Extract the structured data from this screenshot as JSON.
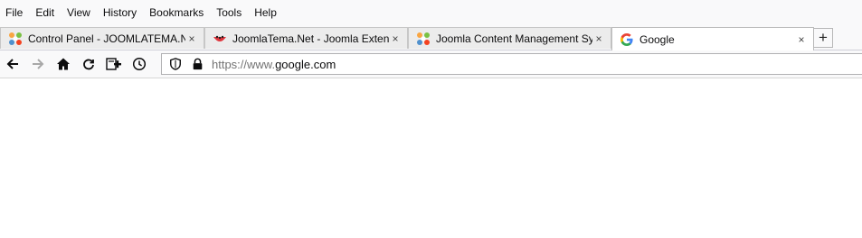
{
  "menu": {
    "items": [
      {
        "label": "File"
      },
      {
        "label": "Edit"
      },
      {
        "label": "View"
      },
      {
        "label": "History"
      },
      {
        "label": "Bookmarks"
      },
      {
        "label": "Tools"
      },
      {
        "label": "Help"
      }
    ]
  },
  "tabs": [
    {
      "title": "Control Panel - JOOMLATEMA.N",
      "icon": "joomla-icon",
      "active": false
    },
    {
      "title": "JoomlaTema.Net - Joomla Exten",
      "icon": "joomlatema-icon",
      "active": false
    },
    {
      "title": "Joomla Content Management Sy",
      "icon": "joomla-icon",
      "active": false
    },
    {
      "title": "Google",
      "icon": "google-icon",
      "active": true
    }
  ],
  "tab_close_glyph": "×",
  "new_tab_glyph": "+",
  "navbar": {
    "url_scheme": "https://www.",
    "url_host": "google.com"
  },
  "colors": {
    "chrome_bg": "#f9f9fa",
    "inactive_tab": "#ececec",
    "active_tab": "#ffffff"
  }
}
